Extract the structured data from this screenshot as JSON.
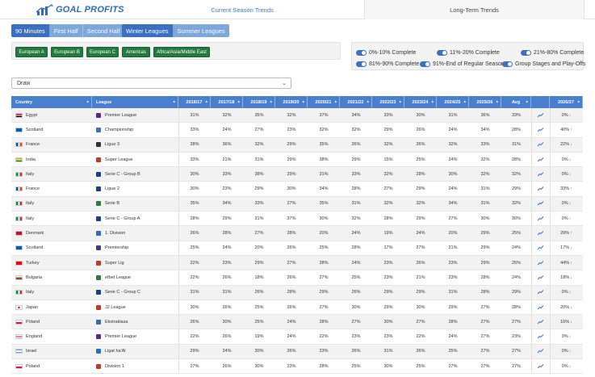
{
  "app": {
    "logo_text": "GOAL PROFITS"
  },
  "tabs": {
    "current": "Current Season Trends",
    "long": "Long-Term Trends"
  },
  "period_buttons": [
    "90 Minutes",
    "First Half",
    "Second Half"
  ],
  "season_buttons": [
    "Winter Leagues",
    "Summer Leagues"
  ],
  "league_groups": [
    "European A",
    "European B",
    "European C",
    "Americas",
    "Africa/Asia/Middle East"
  ],
  "toggles": [
    "0%-10% Complete",
    "11%-20% Complete",
    "21%-80% Complete",
    "81%-90% Complete",
    "91%-End of Regular Season",
    "Group Stages and Play-Offs"
  ],
  "market_select": {
    "value": "Draw"
  },
  "table": {
    "headers": [
      "Country",
      "League",
      "2016/17",
      "2017/18",
      "2018/19",
      "2019/20",
      "2020/21",
      "2021/22",
      "2022/23",
      "2023/24",
      "2024/25",
      "2025/26",
      "Avg",
      "",
      "2026/27"
    ],
    "rows": [
      {
        "country": "Egypt",
        "league": "Premier League",
        "v": [
          "31%",
          "32%",
          "35%",
          "32%",
          "37%",
          "34%",
          "33%",
          "30%",
          "31%",
          "36%",
          "33%"
        ],
        "cur": "0%",
        "dir": "down"
      },
      {
        "country": "Scotland",
        "league": "Championship",
        "v": [
          "33%",
          "24%",
          "27%",
          "23%",
          "32%",
          "32%",
          "29%",
          "26%",
          "24%",
          "34%",
          "28%"
        ],
        "cur": "40%",
        "dir": "up"
      },
      {
        "country": "France",
        "league": "Ligue 3",
        "v": [
          "28%",
          "36%",
          "32%",
          "29%",
          "35%",
          "26%",
          "32%",
          "26%",
          "32%",
          "33%",
          "31%"
        ],
        "cur": "22%",
        "dir": "down"
      },
      {
        "country": "India",
        "league": "Super League",
        "v": [
          "33%",
          "21%",
          "31%",
          "29%",
          "38%",
          "29%",
          "15%",
          "25%",
          "24%",
          "32%",
          "28%"
        ],
        "cur": "0%",
        "dir": "down"
      },
      {
        "country": "Italy",
        "league": "Serie C - Group B",
        "v": [
          "30%",
          "33%",
          "38%",
          "29%",
          "31%",
          "33%",
          "32%",
          "28%",
          "30%",
          "32%",
          "32%"
        ],
        "cur": "0%",
        "dir": "down"
      },
      {
        "country": "France",
        "league": "Ligue 2",
        "v": [
          "30%",
          "23%",
          "29%",
          "30%",
          "34%",
          "28%",
          "27%",
          "29%",
          "24%",
          "31%",
          "29%"
        ],
        "cur": "33%",
        "dir": "up"
      },
      {
        "country": "Italy",
        "league": "Serie B",
        "v": [
          "35%",
          "34%",
          "33%",
          "27%",
          "35%",
          "31%",
          "32%",
          "32%",
          "34%",
          "31%",
          "32%"
        ],
        "cur": "0%",
        "dir": "down"
      },
      {
        "country": "Italy",
        "league": "Serie C - Group A",
        "v": [
          "28%",
          "29%",
          "31%",
          "37%",
          "30%",
          "32%",
          "28%",
          "29%",
          "27%",
          "30%",
          "30%"
        ],
        "cur": "0%",
        "dir": "down"
      },
      {
        "country": "Denmark",
        "league": "1. Division",
        "v": [
          "26%",
          "28%",
          "27%",
          "28%",
          "20%",
          "24%",
          "19%",
          "24%",
          "20%",
          "29%",
          "25%"
        ],
        "cur": "29%",
        "dir": "up"
      },
      {
        "country": "Scotland",
        "league": "Premiership",
        "v": [
          "25%",
          "24%",
          "20%",
          "26%",
          "25%",
          "28%",
          "17%",
          "27%",
          "21%",
          "29%",
          "24%"
        ],
        "cur": "17%",
        "dir": "down"
      },
      {
        "country": "Turkey",
        "league": "Super Lig",
        "v": [
          "22%",
          "23%",
          "29%",
          "27%",
          "28%",
          "24%",
          "23%",
          "26%",
          "23%",
          "29%",
          "25%"
        ],
        "cur": "44%",
        "dir": "up"
      },
      {
        "country": "Bulgaria",
        "league": "efbet League",
        "v": [
          "22%",
          "26%",
          "18%",
          "26%",
          "27%",
          "25%",
          "23%",
          "21%",
          "23%",
          "28%",
          "24%"
        ],
        "cur": "18%",
        "dir": "down"
      },
      {
        "country": "Italy",
        "league": "Serie C - Group C",
        "v": [
          "31%",
          "31%",
          "26%",
          "28%",
          "29%",
          "26%",
          "29%",
          "29%",
          "31%",
          "28%",
          "29%"
        ],
        "cur": "0%",
        "dir": "down"
      },
      {
        "country": "Japan",
        "league": "J2 League",
        "v": [
          "30%",
          "26%",
          "25%",
          "26%",
          "27%",
          "30%",
          "29%",
          "30%",
          "29%",
          "27%",
          "28%"
        ],
        "cur": "20%",
        "dir": "down"
      },
      {
        "country": "Poland",
        "league": "Ekstraklasa",
        "v": [
          "26%",
          "30%",
          "25%",
          "24%",
          "28%",
          "27%",
          "30%",
          "27%",
          "28%",
          "27%",
          "27%"
        ],
        "cur": "16%",
        "dir": "down"
      },
      {
        "country": "England",
        "league": "Premier League",
        "v": [
          "22%",
          "26%",
          "19%",
          "24%",
          "22%",
          "23%",
          "23%",
          "22%",
          "24%",
          "27%",
          "23%"
        ],
        "cur": "0%",
        "dir": "down"
      },
      {
        "country": "Israel",
        "league": "Ligat ha'Al",
        "v": [
          "29%",
          "24%",
          "30%",
          "26%",
          "23%",
          "26%",
          "31%",
          "26%",
          "25%",
          "27%",
          "27%"
        ],
        "cur": "0%",
        "dir": "down"
      },
      {
        "country": "Poland",
        "league": "Division 1",
        "v": [
          "27%",
          "26%",
          "30%",
          "23%",
          "28%",
          "25%",
          "30%",
          "25%",
          "27%",
          "27%",
          "27%"
        ],
        "cur": "0%",
        "dir": "down"
      }
    ]
  },
  "colors": {
    "accent": "#4a7fce",
    "league_btn": "#227a3e",
    "up": "#2a9a45",
    "down": "#d23b3b"
  }
}
